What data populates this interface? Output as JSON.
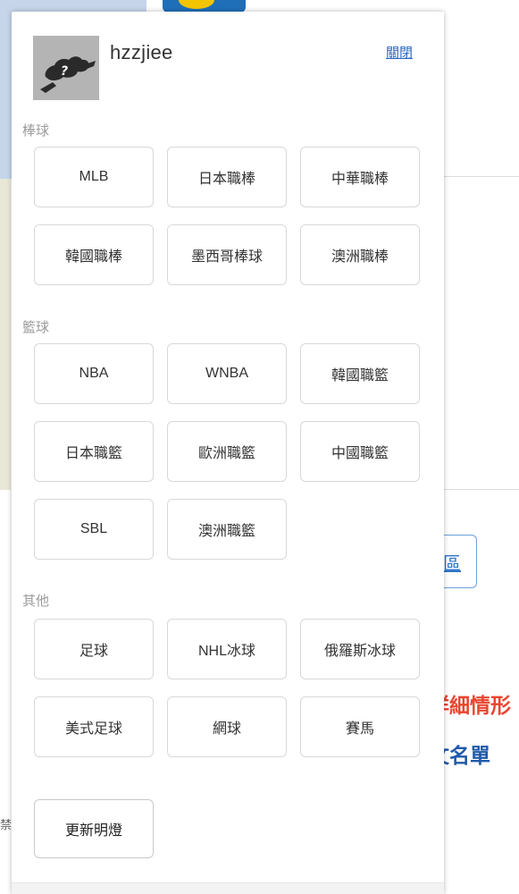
{
  "background": {
    "tab_text": "區",
    "red_text": "詳細情形",
    "blue_text": "文名單",
    "small_text": "禁"
  },
  "panel": {
    "username": "hzzjiee",
    "close_label": "關閉",
    "avatar_icon": "question-mark-avatar-icon",
    "update_label": "更新明燈"
  },
  "sections": [
    {
      "label": "棒球",
      "items": [
        "MLB",
        "日本職棒",
        "中華職棒",
        "韓國職棒",
        "墨西哥棒球",
        "澳洲職棒"
      ]
    },
    {
      "label": "籃球",
      "items": [
        "NBA",
        "WNBA",
        "韓國職籃",
        "日本職籃",
        "歐洲職籃",
        "中國職籃",
        "SBL",
        "澳洲職籃"
      ]
    },
    {
      "label": "其他",
      "items": [
        "足球",
        "NHL冰球",
        "俄羅斯冰球",
        "美式足球",
        "網球",
        "賽馬"
      ]
    }
  ]
}
